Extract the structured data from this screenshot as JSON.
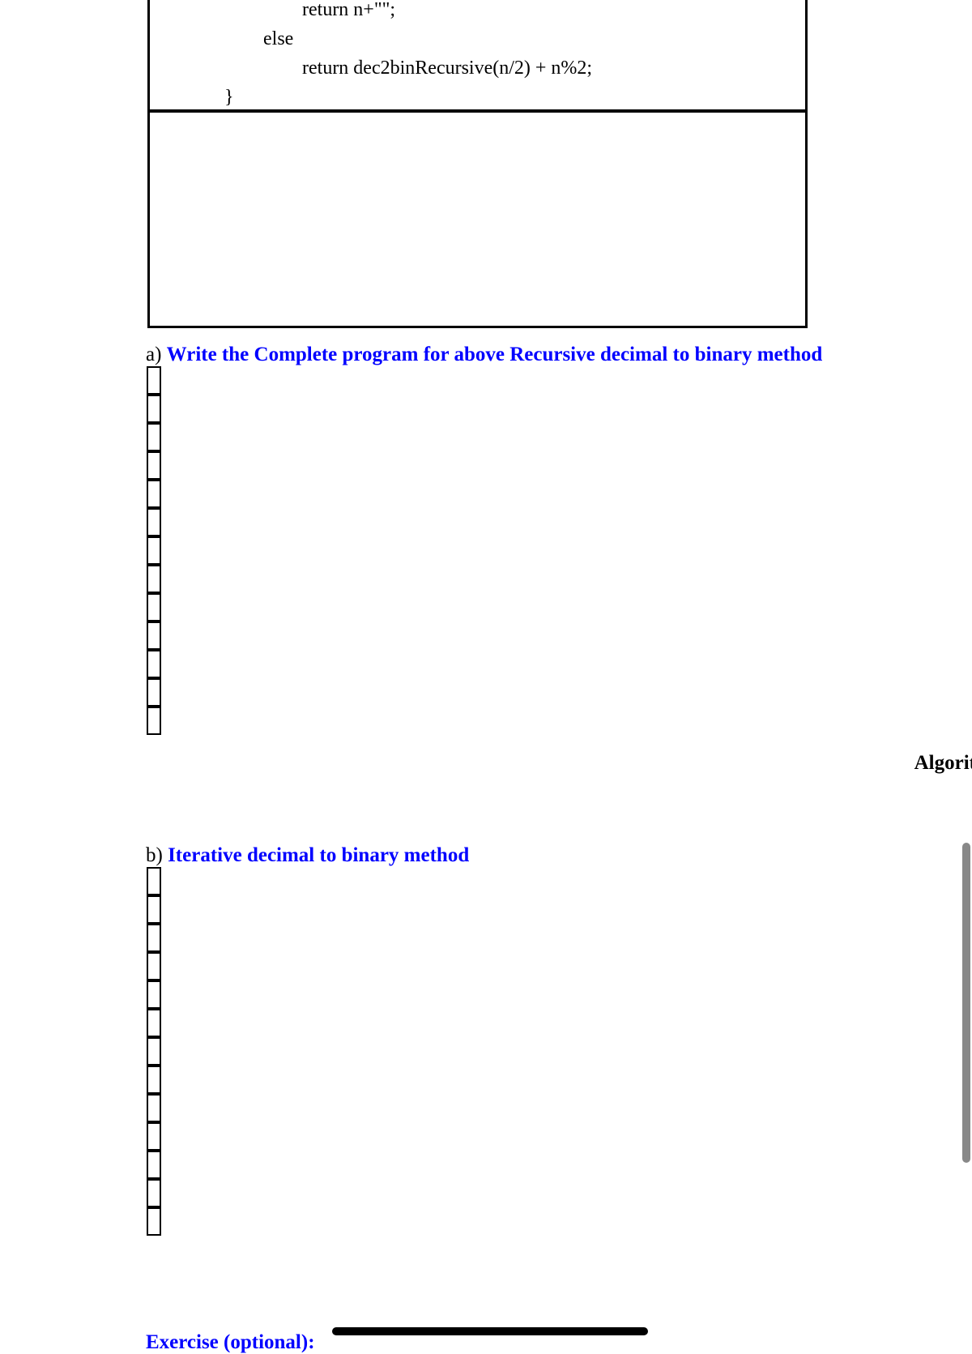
{
  "code": {
    "line1": "                            return n+\"\";",
    "line2": "                    else",
    "line3": "                            return dec2binRecursive(n/2) + n%2;",
    "line4": "            }"
  },
  "prompt_a": {
    "label": "a) ",
    "text": "Write the Complete program for above Recursive decimal to binary method"
  },
  "side_text": "Algorit",
  "prompt_b": {
    "label": "b) ",
    "text": "Iterative decimal to binary method"
  },
  "exercise": {
    "label": "Exercise (optional):"
  }
}
